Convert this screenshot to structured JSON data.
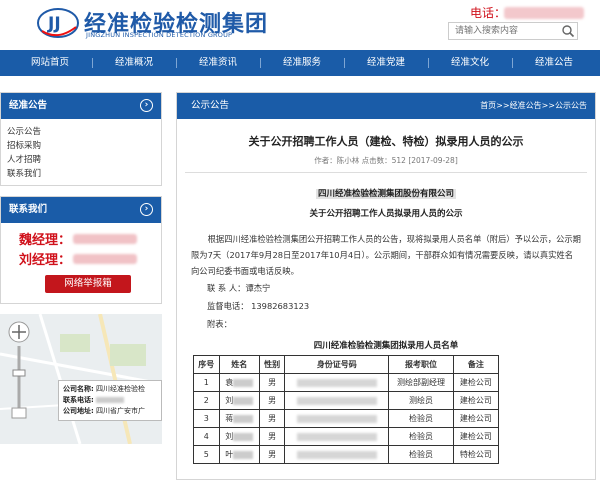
{
  "header": {
    "logo_text": "JJ",
    "title": "经准检验检测集团",
    "subtitle": "JINGZHUN INSPECTION DETECTION GROUP",
    "tel_label": "电话：",
    "search_placeholder": "请输入搜索内容"
  },
  "nav": {
    "items": [
      "网站首页",
      "经准概况",
      "经准资讯",
      "经准服务",
      "经准党建",
      "经准文化",
      "经准公告"
    ]
  },
  "sidebar": {
    "notice_title": "经准公告",
    "notice_items": [
      "公示公告",
      "招标采购",
      "人才招聘",
      "联系我们"
    ],
    "contact_title": "联系我们",
    "contact_1": "魏经理：",
    "contact_2": "刘经理：",
    "report_button": "网络举报箱"
  },
  "map": {
    "company_label": "公司名称:",
    "company_value": "四川经准检验检",
    "phone_label": "联系电话:",
    "address_label": "公司地址:",
    "address_value": "四川省广安市广"
  },
  "main": {
    "section_title": "公示公告",
    "breadcrumb": "首页>>经准公告>>公示公告",
    "article_title": "关于公开招聘工作人员（建检、特检）拟录用人员的公示",
    "article_meta": "作者：陈小林  点击数：512  [2017-09-28]",
    "company": "四川经准检验检测集团股份有限公司",
    "subtitle": "关于公开招聘工作人员拟录用人员的公示",
    "paragraph": "根据四川经准检验检测集团公开招聘工作人员的公告，现将拟录用人员名单（附后）予以公示，公示期限为7天（2017年9月28日至2017年10月4日）。公示期间，干部群众如有情况需要反映，请以真实姓名向公司纪委书面或电话反映。",
    "contact_line": "联 系 人：谭杰宁",
    "phone_line": "监督电话：  13982683123",
    "attachment_line": "附表：",
    "table_title": "四川经准检验检测集团拟录用人员名单"
  },
  "table": {
    "headers": [
      "序号",
      "姓名",
      "性别",
      "身份证号码",
      "报考职位",
      "备注"
    ],
    "rows": [
      {
        "no": "1",
        "name": "袁",
        "gender": "男",
        "position": "测绘部副经理",
        "note": "建检公司"
      },
      {
        "no": "2",
        "name": "刘",
        "gender": "男",
        "position": "测绘员",
        "note": "建检公司"
      },
      {
        "no": "3",
        "name": "蒋",
        "gender": "男",
        "position": "检验员",
        "note": "建检公司"
      },
      {
        "no": "4",
        "name": "刘",
        "gender": "男",
        "position": "检验员",
        "note": "建检公司"
      },
      {
        "no": "5",
        "name": "叶",
        "gender": "男",
        "position": "检验员",
        "note": "特检公司"
      }
    ]
  },
  "colors": {
    "brand_blue": "#1a5ca8",
    "accent_red": "#d0111b",
    "button_red": "#c3161c"
  }
}
